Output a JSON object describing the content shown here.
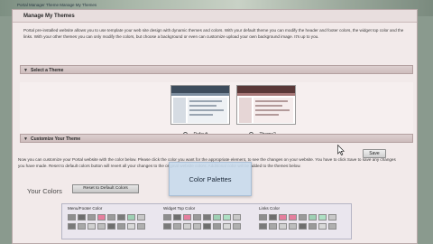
{
  "breadcrumb": "Portal Manager  Theme  Manage My Themes",
  "page_title": "Manage My Themes",
  "intro_text": "Portal pre-installed website allows you to use template your web site design with dynamic themes and colors. With your default theme you can modify the header and footer colors, the widget top color and the links. With your other themes you can only modify the colors, but choose a background or even can customize upload your own background image. It's up to you.",
  "select_theme": {
    "section_label": "Select a Theme",
    "themes": [
      {
        "label": "Default",
        "selected": false
      },
      {
        "label": "Theme2",
        "selected": true
      }
    ]
  },
  "customize": {
    "section_label": "Customize Your Theme",
    "description": "Now you can customize your Portal website with the color below. Please click the color you want for the appropriate element, to see the changes on your website. You have to click Save to save any changes you have made. Reset to default colors button will revert all your changes to the original website colors. Additional color will be added to the themes below.",
    "save_label": "Save",
    "your_colors_label": "Your Colors",
    "reset_label": "Reset to Default Colors",
    "tooltip": "Color Palettes",
    "palettes": [
      {
        "label": "Menu/Footer Color",
        "row1": [
          "#8e8e8e",
          "#6e6e6e",
          "#9a9a9a",
          "#e57f9e",
          "#9a9a9a",
          "#7a7a7a",
          "#9fd0b4",
          "#c8c8c8"
        ],
        "row2": [
          "#7a7a7a",
          "#a8a8a8",
          "#d0d0d0",
          "#bdbdbd",
          "#6f6f6f",
          "#9a9a9a",
          "#d8d8d8",
          "#b0b0b0"
        ]
      },
      {
        "label": "Widget Top Color",
        "row1": [
          "#8e8e8e",
          "#6e6e6e",
          "#e57f9e",
          "#9a9a9a",
          "#7a7a7a",
          "#9fd0b4",
          "#aee0c4",
          "#c8c8c8"
        ],
        "row2": [
          "#7a7a7a",
          "#a8a8a8",
          "#d0d0d0",
          "#bdbdbd",
          "#6f6f6f",
          "#9a9a9a",
          "#d8d8d8",
          "#b0b0b0"
        ]
      },
      {
        "label": "Links Color",
        "row1": [
          "#8e8e8e",
          "#6e6e6e",
          "#e57f9e",
          "#e57f9e",
          "#9a9a9a",
          "#9fd0b4",
          "#aee0c4",
          "#c8c8c8"
        ],
        "row2": [
          "#7a7a7a",
          "#a8a8a8",
          "#d0d0d0",
          "#bdbdbd",
          "#6f6f6f",
          "#9a9a9a",
          "#d8d8d8",
          "#b0b0b0"
        ]
      }
    ]
  },
  "colors": {
    "panel_bg": "#f2eaea",
    "section_bar": "#cdbcbc",
    "tooltip_bg": "#c6daec"
  }
}
